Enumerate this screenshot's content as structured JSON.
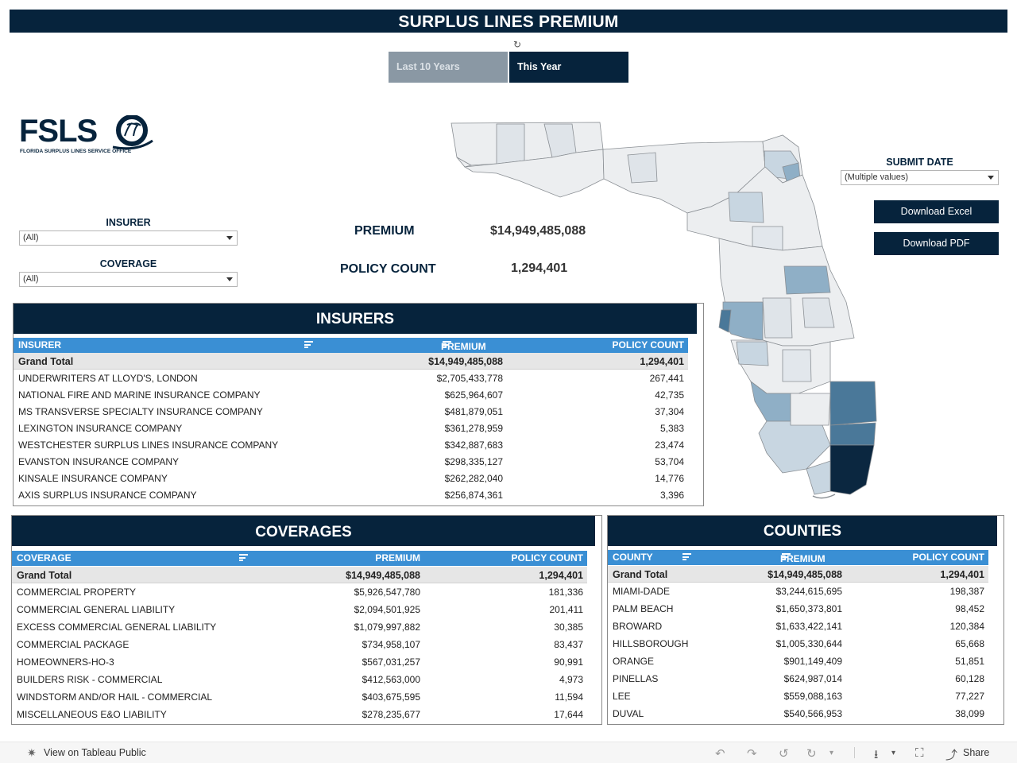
{
  "header": {
    "title": "SURPLUS LINES PREMIUM"
  },
  "period_toggle": {
    "options": [
      "Last 10 Years",
      "This Year"
    ],
    "selected": "This Year"
  },
  "logo": {
    "text": "FSLSO",
    "tagline": "FLORIDA SURPLUS LINES SERVICE OFFICE"
  },
  "filters": {
    "insurer": {
      "label": "INSURER",
      "value": "(All)"
    },
    "coverage": {
      "label": "COVERAGE",
      "value": "(All)"
    },
    "submit_date": {
      "label": "SUBMIT DATE",
      "value": "(Multiple values)"
    }
  },
  "kpis": {
    "premium": {
      "label": "PREMIUM",
      "value": "$14,949,485,088"
    },
    "policy_count": {
      "label": "POLICY COUNT",
      "value": "1,294,401"
    }
  },
  "buttons": {
    "excel": "Download Excel",
    "pdf": "Download PDF"
  },
  "colors": {
    "navy": "#06233c",
    "header_blue": "#3a8fd4",
    "map_dark": "#0b2740",
    "map_mid": "#4a7899",
    "map_light": "#8fafc6",
    "map_pale": "#c8d6e1",
    "map_base": "#eceef0"
  },
  "insurers": {
    "title": "INSURERS",
    "columns": [
      "INSURER",
      "PREMIUM",
      "POLICY COUNT"
    ],
    "total": {
      "name": "Grand Total",
      "premium": "$14,949,485,088",
      "count": "1,294,401"
    },
    "rows": [
      {
        "name": "UNDERWRITERS AT LLOYD'S, LONDON",
        "premium": "$2,705,433,778",
        "count": "267,441"
      },
      {
        "name": "NATIONAL FIRE AND MARINE INSURANCE COMPANY",
        "premium": "$625,964,607",
        "count": "42,735"
      },
      {
        "name": "MS TRANSVERSE SPECIALTY INSURANCE COMPANY",
        "premium": "$481,879,051",
        "count": "37,304"
      },
      {
        "name": "LEXINGTON INSURANCE COMPANY",
        "premium": "$361,278,959",
        "count": "5,383"
      },
      {
        "name": "WESTCHESTER SURPLUS LINES INSURANCE COMPANY",
        "premium": "$342,887,683",
        "count": "23,474"
      },
      {
        "name": "EVANSTON INSURANCE COMPANY",
        "premium": "$298,335,127",
        "count": "53,704"
      },
      {
        "name": "KINSALE INSURANCE COMPANY",
        "premium": "$262,282,040",
        "count": "14,776"
      },
      {
        "name": "AXIS SURPLUS INSURANCE COMPANY",
        "premium": "$256,874,361",
        "count": "3,396"
      }
    ]
  },
  "coverages": {
    "title": "COVERAGES",
    "columns": [
      "COVERAGE",
      "PREMIUM",
      "POLICY COUNT"
    ],
    "total": {
      "name": "Grand Total",
      "premium": "$14,949,485,088",
      "count": "1,294,401"
    },
    "rows": [
      {
        "name": "COMMERCIAL PROPERTY",
        "premium": "$5,926,547,780",
        "count": "181,336"
      },
      {
        "name": "COMMERCIAL GENERAL LIABILITY",
        "premium": "$2,094,501,925",
        "count": "201,411"
      },
      {
        "name": "EXCESS COMMERCIAL GENERAL LIABILITY",
        "premium": "$1,079,997,882",
        "count": "30,385"
      },
      {
        "name": "COMMERCIAL PACKAGE",
        "premium": "$734,958,107",
        "count": "83,437"
      },
      {
        "name": "HOMEOWNERS-HO-3",
        "premium": "$567,031,257",
        "count": "90,991"
      },
      {
        "name": "BUILDERS RISK - COMMERCIAL",
        "premium": "$412,563,000",
        "count": "4,973"
      },
      {
        "name": "WINDSTORM AND/OR HAIL - COMMERCIAL",
        "premium": "$403,675,595",
        "count": "11,594"
      },
      {
        "name": "MISCELLANEOUS E&O LIABILITY",
        "premium": "$278,235,677",
        "count": "17,644"
      }
    ]
  },
  "counties": {
    "title": "COUNTIES",
    "columns": [
      "COUNTY",
      "PREMIUM",
      "POLICY COUNT"
    ],
    "total": {
      "name": "Grand Total",
      "premium": "$14,949,485,088",
      "count": "1,294,401"
    },
    "rows": [
      {
        "name": "MIAMI-DADE",
        "premium": "$3,244,615,695",
        "count": "198,387"
      },
      {
        "name": "PALM BEACH",
        "premium": "$1,650,373,801",
        "count": "98,452"
      },
      {
        "name": "BROWARD",
        "premium": "$1,633,422,141",
        "count": "120,384"
      },
      {
        "name": "HILLSBOROUGH",
        "premium": "$1,005,330,644",
        "count": "65,668"
      },
      {
        "name": "ORANGE",
        "premium": "$901,149,409",
        "count": "51,851"
      },
      {
        "name": "PINELLAS",
        "premium": "$624,987,014",
        "count": "60,128"
      },
      {
        "name": "LEE",
        "premium": "$559,088,163",
        "count": "77,227"
      },
      {
        "name": "DUVAL",
        "premium": "$540,566,953",
        "count": "38,099"
      }
    ]
  },
  "footer": {
    "view_label": "View on Tableau Public",
    "share_label": "Share"
  }
}
